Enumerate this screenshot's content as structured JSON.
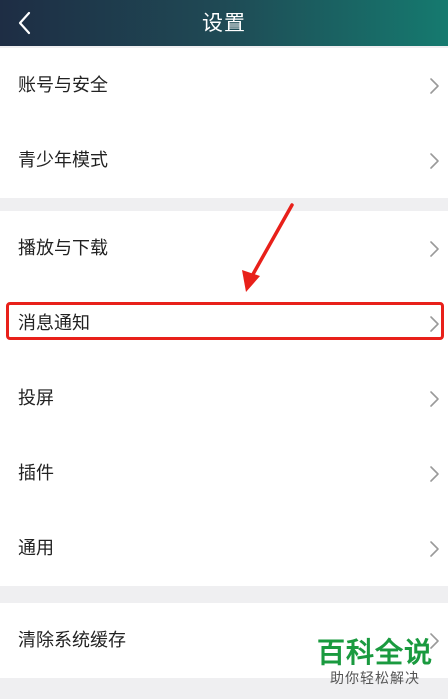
{
  "header": {
    "title": "设置",
    "back_icon": "chevron-left-icon"
  },
  "menu": {
    "group1": [
      {
        "label": "账号与安全"
      },
      {
        "label": "青少年模式"
      }
    ],
    "group2": [
      {
        "label": "播放与下载"
      },
      {
        "label": "消息通知"
      },
      {
        "label": "投屏"
      },
      {
        "label": "插件"
      },
      {
        "label": "通用"
      }
    ],
    "group3": [
      {
        "label": "清除系统缓存"
      }
    ],
    "chevron_icon": "chevron-right-icon"
  },
  "annotation": {
    "highlight_target": "消息通知",
    "color": "#e8201a"
  },
  "watermark": {
    "title": "百科全说",
    "subtitle": "助你轻松解决"
  },
  "colors": {
    "header_gradient_start": "#1e2d44",
    "header_gradient_end": "#157a6f",
    "page_background": "#efeff1",
    "watermark_green": "#1a9a3f"
  }
}
